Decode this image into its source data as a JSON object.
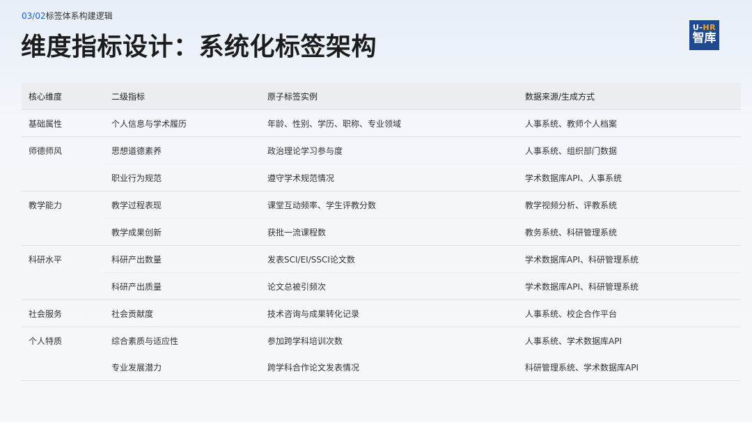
{
  "header": {
    "crumb_num": "03/02",
    "crumb_text": "标签体系构建逻辑",
    "title": "维度指标设计：系统化标签架构"
  },
  "logo": {
    "line1_a": "U-",
    "line1_b": "HR",
    "line2": "智库"
  },
  "table": {
    "headers": [
      "核心维度",
      "二级指标",
      "原子标签实例",
      "数据来源/生成方式"
    ],
    "rows": [
      {
        "dim": "基础属性",
        "metric": "个人信息与学术履历",
        "tags": "年龄、性别、学历、职称、专业领域",
        "source": "人事系统、教师个人档案"
      },
      {
        "dim": "师德师风",
        "metric": "思想道德素养",
        "tags": "政治理论学习参与度",
        "source": "人事系统、组织部门数据"
      },
      {
        "dim": "",
        "metric": "职业行为规范",
        "tags": "遵守学术规范情况",
        "source": "学术数据库API、人事系统"
      },
      {
        "dim": "教学能力",
        "metric": "教学过程表现",
        "tags": "课堂互动频率、学生评教分数",
        "source": "教学视频分析、评教系统"
      },
      {
        "dim": "",
        "metric": "教学成果创新",
        "tags": "获批一流课程数",
        "source": "教务系统、科研管理系统"
      },
      {
        "dim": "科研水平",
        "metric": "科研产出数量",
        "tags": "发表SCI/EI/SSCI论文数",
        "source": "学术数据库API、科研管理系统"
      },
      {
        "dim": "",
        "metric": "科研产出质量",
        "tags": "论文总被引频次",
        "source": "学术数据库API、科研管理系统"
      },
      {
        "dim": "社会服务",
        "metric": "社会贡献度",
        "tags": "技术咨询与成果转化记录",
        "source": "人事系统、校企合作平台"
      },
      {
        "dim": "个人特质",
        "metric": "综合素质与适应性",
        "tags": "参加跨学科培训次数",
        "source": "人事系统、学术数据库API"
      },
      {
        "dim": "",
        "metric": "专业发展潜力",
        "tags": "跨学科合作论文发表情况",
        "source": "科研管理系统、学术数据库API"
      }
    ]
  }
}
